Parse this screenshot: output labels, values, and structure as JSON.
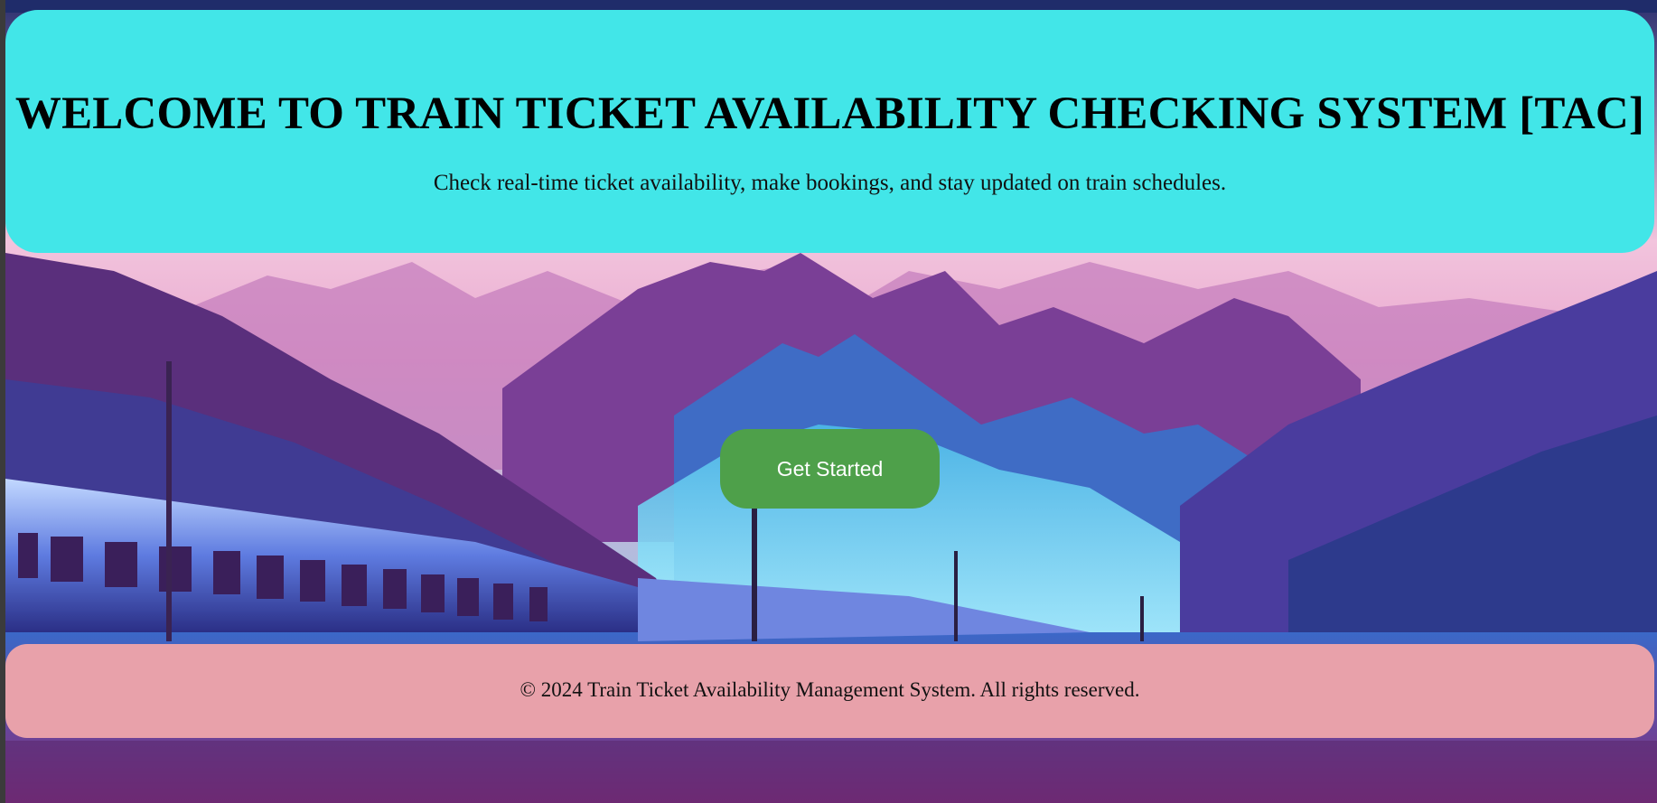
{
  "header": {
    "title": "WELCOME TO TRAIN TICKET AVAILABILITY CHECKING SYSTEM [TAC]",
    "subtitle": "Check real-time ticket availability, make bookings, and stay updated on train schedules."
  },
  "cta": {
    "label": "Get Started"
  },
  "footer": {
    "text": "© 2024 Train Ticket Availability Management System. All rights reserved."
  },
  "colors": {
    "header_bg": "#42e6e8",
    "button_bg": "#4ea04a",
    "footer_bg": "#e8a1aa"
  },
  "background": {
    "scene": "purple-blue mountains with train"
  }
}
